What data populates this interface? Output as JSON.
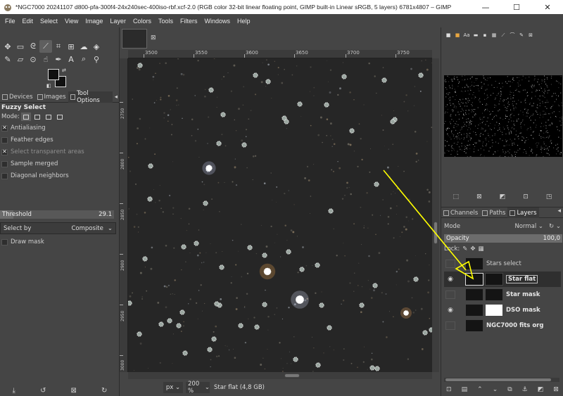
{
  "window": {
    "title": "*NGC7000 20241107 d800-pfa-300f4-24x240sec-400iso-rbf.xcf-2.0 (RGB color 32-bit linear floating point, GIMP built-in Linear sRGB, 5 layers) 6781x4807 – GIMP",
    "minimize": "—",
    "maximize": "☐",
    "close": "✕"
  },
  "menu": [
    "File",
    "Edit",
    "Select",
    "View",
    "Image",
    "Layer",
    "Colors",
    "Tools",
    "Filters",
    "Windows",
    "Help"
  ],
  "left_dock": {
    "tabs": [
      {
        "label": "Devices"
      },
      {
        "label": "Images"
      },
      {
        "label": "Tool Options"
      }
    ],
    "tool_title": "Fuzzy Select",
    "mode_label": "Mode:",
    "options": [
      {
        "label": "Antialiasing",
        "checked": "✕"
      },
      {
        "label": "Feather edges",
        "checked": ""
      },
      {
        "label": "Select transparent areas",
        "checked": "✕"
      },
      {
        "label": "Sample merged",
        "checked": ""
      },
      {
        "label": "Diagonal neighbors",
        "checked": ""
      }
    ],
    "threshold_label": "Threshold",
    "threshold_value": "29.1",
    "threshold_fraction": 0.116,
    "select_by_label": "Select by",
    "select_by_value": "Composite",
    "draw_mask": "Draw mask"
  },
  "rulers": {
    "h_labels": [
      "3500",
      "3550",
      "3600",
      "3650",
      "3700",
      "3750"
    ],
    "v_labels": [
      "2750",
      "2800",
      "2850",
      "2900",
      "2950",
      "3000"
    ]
  },
  "status": {
    "unit": "px",
    "zoom": "200 %",
    "message": "Star flat (4,8 GB)"
  },
  "layers_panel": {
    "tabs": [
      {
        "label": "Channels"
      },
      {
        "label": "Paths"
      },
      {
        "label": "Layers"
      }
    ],
    "mode_label": "Mode",
    "mode_value": "Normal",
    "opacity_label": "Opacity",
    "opacity_value": "100,0",
    "lock_label": "Lock:",
    "layers": [
      {
        "name": "Stars select",
        "visible": false,
        "has_mask": false,
        "selected": false
      },
      {
        "name": "Star flat",
        "visible": true,
        "has_mask": true,
        "selected": true
      },
      {
        "name": "Star mask",
        "visible": false,
        "has_mask": true,
        "selected": false
      },
      {
        "name": "DSO mask",
        "visible": true,
        "has_mask": true,
        "selected": false
      },
      {
        "name": "NGC7000 fits org",
        "visible": false,
        "has_mask": false,
        "selected": false
      }
    ]
  },
  "colors": {
    "annotation_arrow": "#ffff00",
    "selection_outline": "#ffffff",
    "foreground": "#111111",
    "background": "#111111"
  }
}
